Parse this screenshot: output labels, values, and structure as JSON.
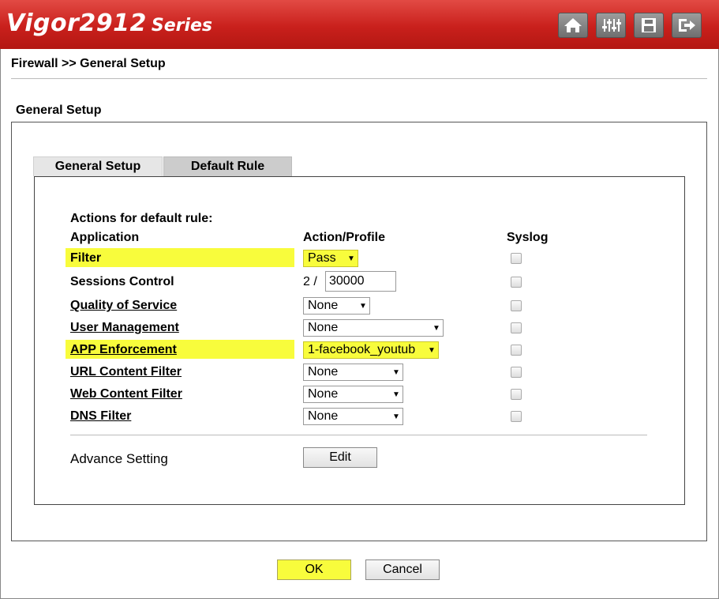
{
  "header": {
    "model": "Vigor2912",
    "series": "Series",
    "icons": [
      "home-icon",
      "settings-sliders-icon",
      "save-icon",
      "logout-icon"
    ]
  },
  "breadcrumb": "Firewall >> General Setup",
  "section_title": "General Setup",
  "tabs": [
    {
      "label": "General Setup",
      "active": false
    },
    {
      "label": "Default Rule",
      "active": true
    }
  ],
  "rule": {
    "heading": "Actions for default rule:",
    "col_application": "Application",
    "col_action": "Action/Profile",
    "col_syslog": "Syslog",
    "rows": [
      {
        "name": "Filter",
        "action": "Pass"
      },
      {
        "name": "Sessions Control",
        "current": "2",
        "separator": "/",
        "limit": "30000"
      },
      {
        "name": "Quality of Service",
        "action": "None"
      },
      {
        "name": "User Management",
        "action": "None"
      },
      {
        "name": "APP Enforcement",
        "action": "1-facebook_youtub"
      },
      {
        "name": "URL Content Filter",
        "action": "None"
      },
      {
        "name": "Web Content Filter",
        "action": "None"
      },
      {
        "name": "DNS Filter",
        "action": "None"
      }
    ],
    "advance_label": "Advance Setting",
    "edit_label": "Edit"
  },
  "buttons": {
    "ok": "OK",
    "cancel": "Cancel"
  },
  "colors": {
    "header_red": "#c9201c",
    "highlight_yellow": "#f8fc3c"
  }
}
